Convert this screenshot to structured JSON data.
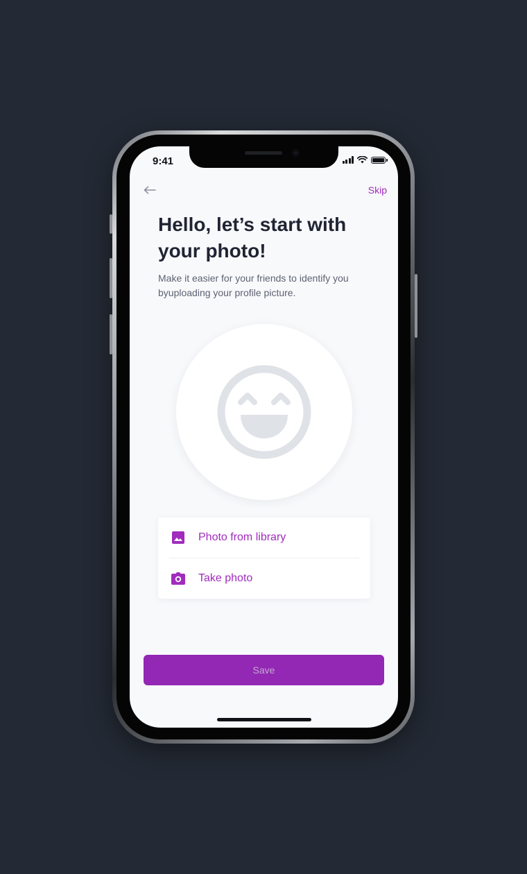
{
  "status_bar": {
    "time": "9:41"
  },
  "nav": {
    "skip_label": "Skip"
  },
  "header": {
    "title": "Hello, let’s start with your photo!",
    "subtitle": "Make it easier for your friends to identify you byuploading your profile picture."
  },
  "avatar": {
    "icon": "smiley-face-icon"
  },
  "options": [
    {
      "label": "Photo from library",
      "icon": "image-icon"
    },
    {
      "label": "Take photo",
      "icon": "camera-icon"
    }
  ],
  "actions": {
    "save_label": "Save"
  },
  "colors": {
    "accent": "#a02bbd",
    "button": "#9228b3",
    "background": "#242a35",
    "screen": "#f8f9fb"
  }
}
